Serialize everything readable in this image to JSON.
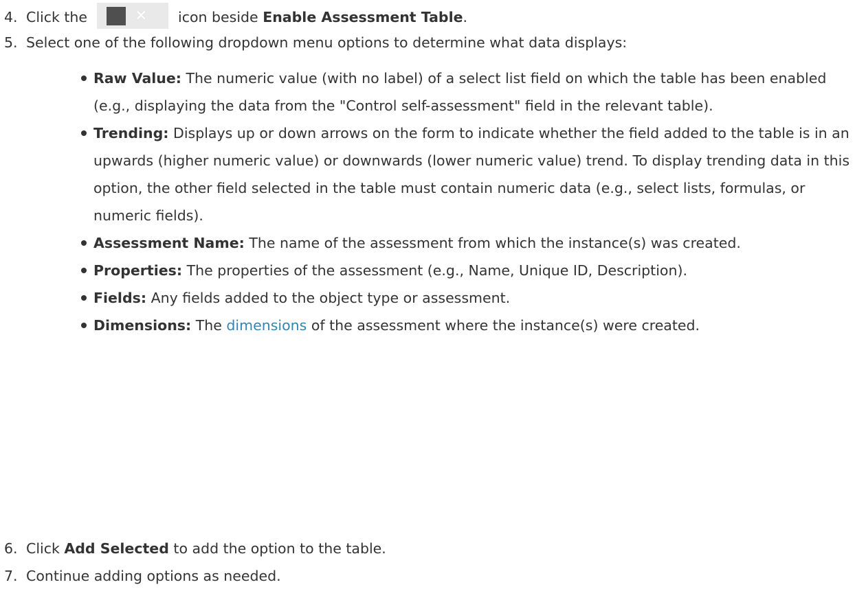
{
  "step4": {
    "number": "4.",
    "before": "Click the",
    "after": "icon beside",
    "bold": "Enable Assessment Table",
    "end": ".",
    "icon": "toggle-off-icon"
  },
  "step5": {
    "number": "5.",
    "text": "Select one of the following dropdown menu options to determine what data displays:"
  },
  "bullets": [
    {
      "term": "Raw Value:",
      "text": "The numeric value (with no label) of a select list field on which the table has been enabled (e.g., displaying the data from the \"Control self-assessment\" field in the relevant table)."
    },
    {
      "term": "Trending:",
      "text": "Displays up or down arrows on the form to indicate whether the field added to the table is in an upwards (higher numeric value) or downwards (lower numeric value) trend. To display trending data in this option, the other field selected in the table must contain numeric data (e.g., select lists, formulas, or numeric fields)."
    },
    {
      "term": "Assessment Name:",
      "text": "The name of the assessment from which the instance(s) was created."
    },
    {
      "term": "Properties:",
      "text": "The properties of the assessment (e.g., Name, Unique ID, Description)."
    },
    {
      "term": "Fields:",
      "text": "Any fields added to the object type or assessment."
    },
    {
      "term": "Dimensions:",
      "before": "The",
      "link": "dimensions",
      "after": "of the assessment where the instance(s) were created."
    }
  ],
  "step6": {
    "number": "6.",
    "before": "Click",
    "bold": "Add Selected",
    "after": "to add the option to the table."
  },
  "step7": {
    "number": "7.",
    "text": "Continue adding options as needed."
  },
  "colors": {
    "text": "#333333",
    "link": "#2e86b5",
    "toggle_bg": "#e9e9e9",
    "toggle_knob": "#4f4f4f"
  }
}
